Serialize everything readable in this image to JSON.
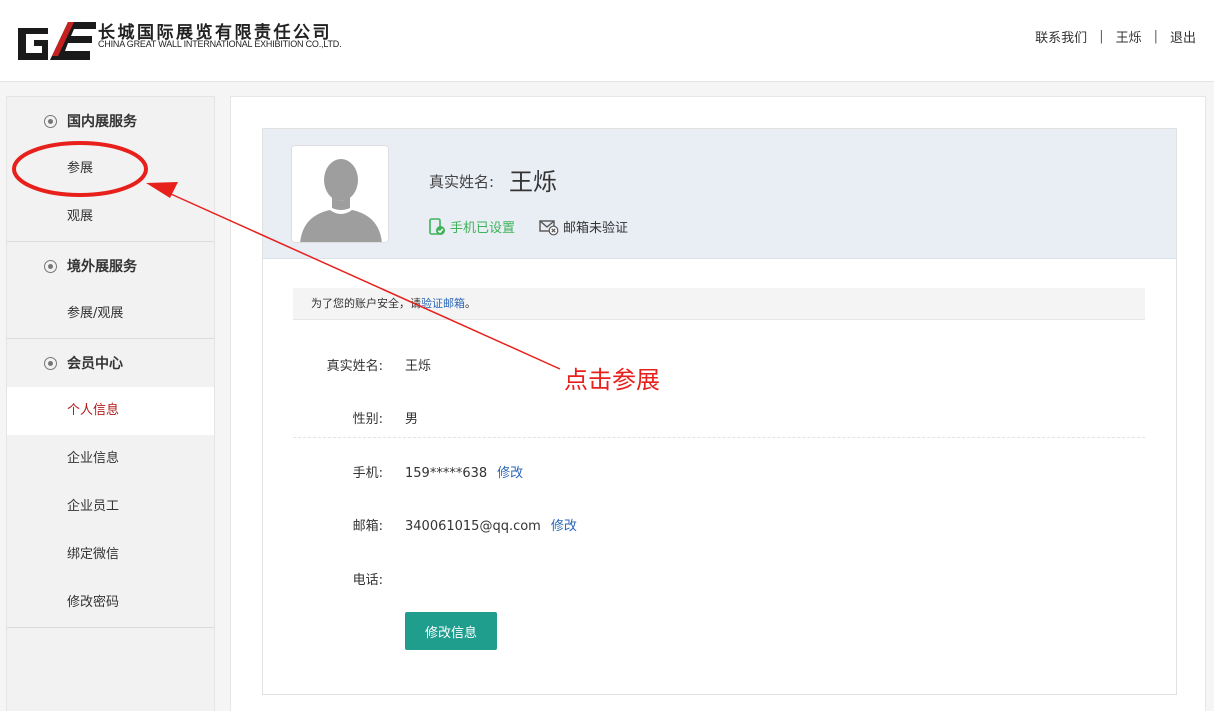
{
  "header": {
    "logo_mark": "GE",
    "company_cn": "长城国际展览有限责任公司",
    "company_en": "CHINA GREAT WALL INTERNATIONAL EXHIBITION CO.,LTD.",
    "nav": {
      "contact": "联系我们",
      "separator": "|",
      "user": "王烁",
      "logout": "退出"
    }
  },
  "sidebar": {
    "sections": [
      {
        "title": "国内展服务",
        "items": [
          "参展",
          "观展"
        ]
      },
      {
        "title": "境外展服务",
        "items": [
          "参展/观展"
        ]
      },
      {
        "title": "会员中心",
        "items": [
          "个人信息",
          "企业信息",
          "企业员工",
          "绑定微信",
          "修改密码"
        ]
      }
    ],
    "active_item": "个人信息"
  },
  "profile": {
    "real_name_label": "真实姓名:",
    "real_name": "王烁",
    "phone_badge": "手机已设置",
    "email_badge": "邮箱未验证"
  },
  "notice": {
    "text": "为了您的账户安全，请",
    "link": "验证邮箱",
    "end": "。"
  },
  "fields": {
    "name_label": "真实姓名:",
    "name_value": "王烁",
    "gender_label": "性别:",
    "gender_value": "男",
    "phone_label": "手机:",
    "phone_value": "159*****638",
    "phone_edit": "修改",
    "email_label": "邮箱:",
    "email_value": "340061015@qq.com",
    "email_edit": "修改",
    "tel_label": "电话:",
    "tel_value": ""
  },
  "edit_button": "修改信息",
  "annotation": {
    "text": "点击参展",
    "color": "#e8201c"
  },
  "colors": {
    "accent": "#1f9e8e",
    "active": "#b31b1b",
    "link": "#2a66b6",
    "success": "#3fb35a"
  }
}
